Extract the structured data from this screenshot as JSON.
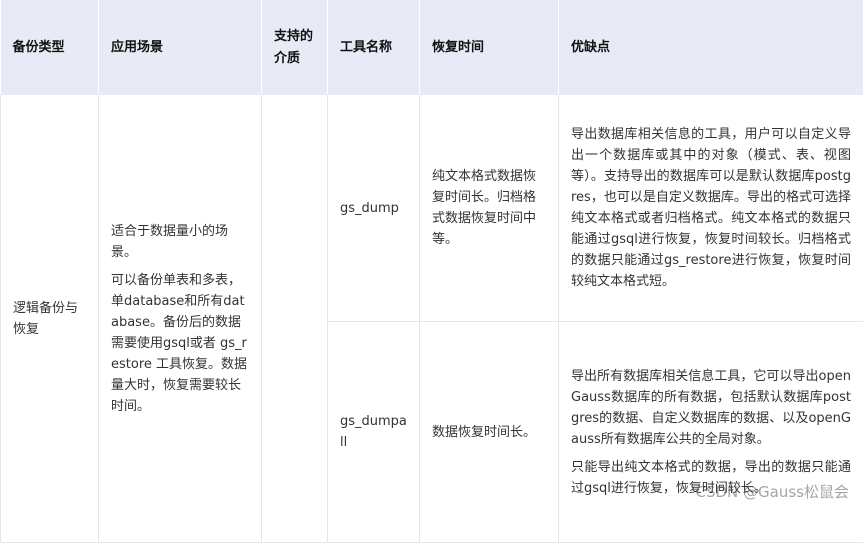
{
  "headers": {
    "backup_type": "备份类型",
    "scenario": "应用场景",
    "media": "支持的介质",
    "tool_name": "工具名称",
    "recovery_time": "恢复时间",
    "pros_cons": "优缺点"
  },
  "group": {
    "backup_type": "逻辑备份与恢复",
    "scenario_p1": "适合于数据量小的场景。",
    "scenario_p2": "可以备份单表和多表，单database和所有database。备份后的数据需要使用gsql或者 gs_restore 工具恢复。数据量大时，恢复需要较长时间。",
    "media": ""
  },
  "rows": [
    {
      "tool_name": "gs_dump",
      "recovery_time": "纯文本格式数据恢复时间长。归档格式数据恢复时间中等。",
      "pros_p1": "导出数据库相关信息的工具，用户可以自定义导出一个数据库或其中的对象（模式、表、视图等）。支持导出的数据库可以是默认数据库postgres，也可以是自定义数据库。导出的格式可选择纯文本格式或者归档格式。纯文本格式的数据只能通过gsql进行恢复，恢复时间较长。归档格式的数据只能通过gs_restore进行恢复，恢复时间较纯文本格式短。",
      "pros_p2": ""
    },
    {
      "tool_name": "gs_dumpall",
      "recovery_time": "数据恢复时间长。",
      "pros_p1": "导出所有数据库相关信息工具，它可以导出openGauss数据库的所有数据，包括默认数据库postgres的数据、自定义数据库的数据、以及openGauss所有数据库公共的全局对象。",
      "pros_p2": "只能导出纯文本格式的数据，导出的数据只能通过gsql进行恢复，恢复时间较长。"
    }
  ],
  "watermark": "CSDN @Gauss松鼠会"
}
